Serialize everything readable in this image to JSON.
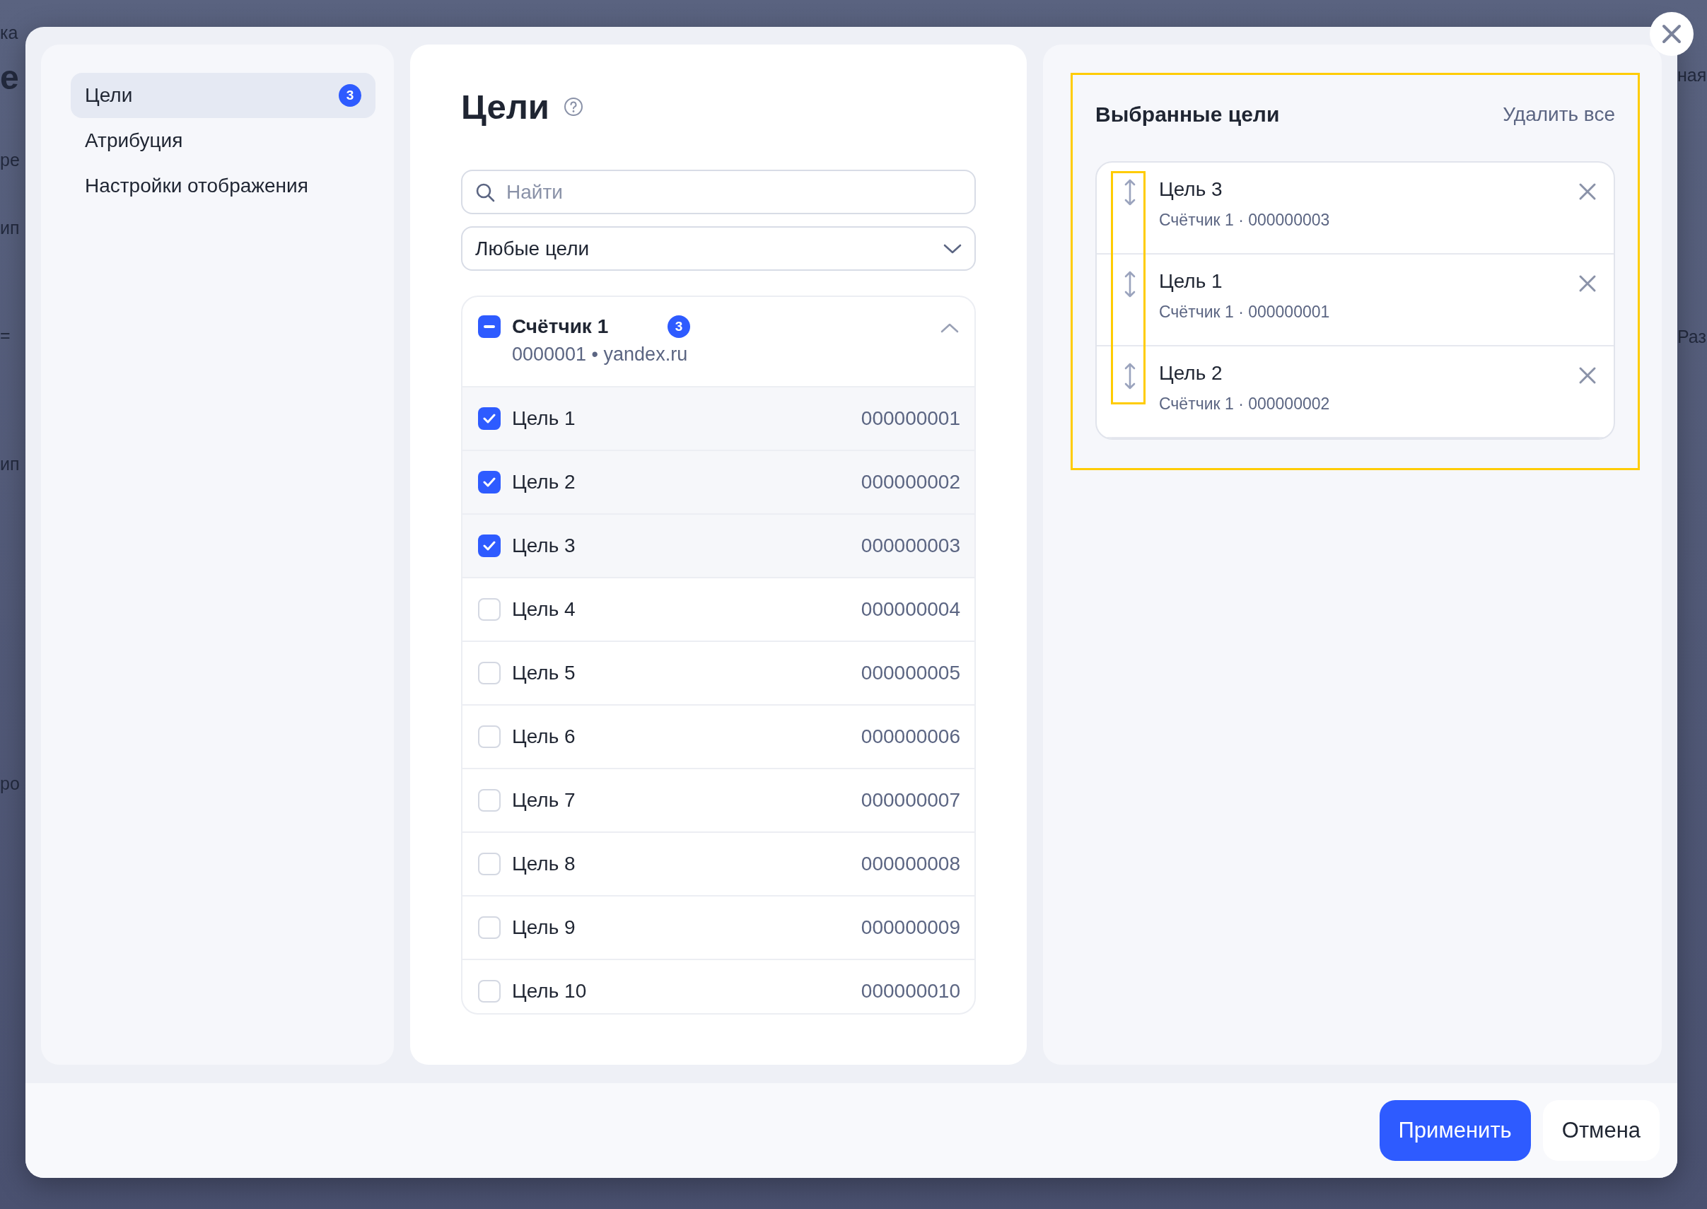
{
  "backdrop": {
    "left_fragments": [
      "ка",
      "е",
      "ре",
      "ип",
      "=",
      "ип",
      "ро"
    ],
    "right_fragments": [
      "ная",
      "Раз"
    ]
  },
  "sidebar": {
    "items": [
      {
        "label": "Цели",
        "badge": "3",
        "selected": true
      },
      {
        "label": "Атрибуция",
        "selected": false
      },
      {
        "label": "Настройки отображения",
        "selected": false
      }
    ]
  },
  "goals_panel": {
    "title": "Цели",
    "search": {
      "placeholder": "Найти"
    },
    "filter": {
      "value": "Любые цели"
    },
    "counter": {
      "name": "Счётчик 1",
      "badge": "3",
      "subtitle": "0000001 • yandex.ru",
      "checked": true,
      "indeterminate": true,
      "expanded": true,
      "goals": [
        {
          "name": "Цель 1",
          "id": "000000001",
          "checked": true
        },
        {
          "name": "Цель 2",
          "id": "000000002",
          "checked": true
        },
        {
          "name": "Цель 3",
          "id": "000000003",
          "checked": true
        },
        {
          "name": "Цель 4",
          "id": "000000004",
          "checked": false
        },
        {
          "name": "Цель 5",
          "id": "000000005",
          "checked": false
        },
        {
          "name": "Цель 6",
          "id": "000000006",
          "checked": false
        },
        {
          "name": "Цель 7",
          "id": "000000007",
          "checked": false
        },
        {
          "name": "Цель 8",
          "id": "000000008",
          "checked": false
        },
        {
          "name": "Цель 9",
          "id": "000000009",
          "checked": false
        },
        {
          "name": "Цель 10",
          "id": "000000010",
          "checked": false
        }
      ]
    }
  },
  "selected_panel": {
    "title": "Выбранные цели",
    "clear_link": "Удалить все",
    "items": [
      {
        "name": "Цель 3",
        "meta": "Счётчик 1 · 000000003"
      },
      {
        "name": "Цель 1",
        "meta": "Счётчик 1 · 000000001"
      },
      {
        "name": "Цель 2",
        "meta": "Счётчик 1 · 000000002"
      }
    ]
  },
  "footer": {
    "buttons": [
      {
        "label": "Применить",
        "kind": "primary"
      },
      {
        "label": "Отмена",
        "kind": "secondary"
      }
    ]
  }
}
